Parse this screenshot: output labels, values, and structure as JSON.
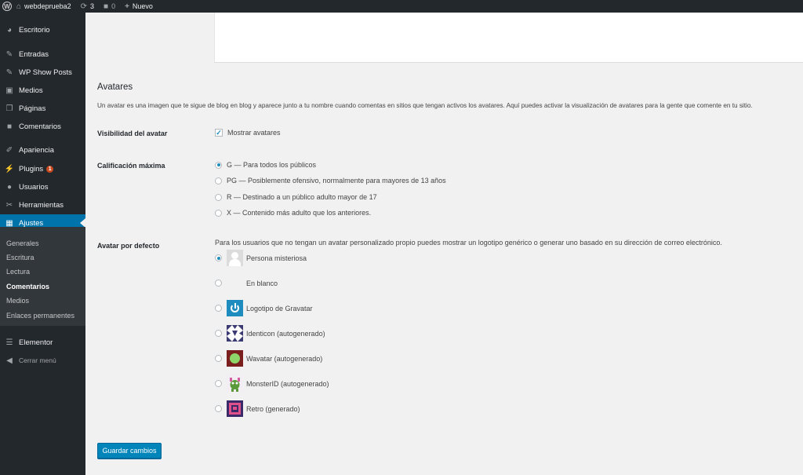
{
  "adminbar": {
    "site_name": "webdeprueba2",
    "updates_count": "3",
    "comments_count": "0",
    "new_label": "Nuevo"
  },
  "sidebar": {
    "items": [
      {
        "label": "Escritorio",
        "icon": "dashboard-icon"
      },
      {
        "label": "Entradas",
        "icon": "pin-icon"
      },
      {
        "label": "WP Show Posts",
        "icon": "pin-icon"
      },
      {
        "label": "Medios",
        "icon": "media-icon"
      },
      {
        "label": "Páginas",
        "icon": "pages-icon"
      },
      {
        "label": "Comentarios",
        "icon": "comment-icon"
      },
      {
        "label": "Apariencia",
        "icon": "brush-icon"
      },
      {
        "label": "Plugins",
        "icon": "plugin-icon",
        "badge": "1"
      },
      {
        "label": "Usuarios",
        "icon": "user-icon"
      },
      {
        "label": "Herramientas",
        "icon": "wrench-icon"
      },
      {
        "label": "Ajustes",
        "icon": "settings-icon",
        "active": true
      },
      {
        "label": "Elementor",
        "icon": "elementor-icon"
      },
      {
        "label": "Cerrar menú",
        "icon": "collapse-icon"
      }
    ],
    "submenu": [
      "Generales",
      "Escritura",
      "Lectura",
      "Comentarios",
      "Medios",
      "Enlaces permanentes"
    ],
    "submenu_current": "Comentarios"
  },
  "section": {
    "title": "Avatares",
    "description": "Un avatar es una imagen que te sigue de blog en blog y aparece junto a tu nombre cuando comentas en sitios que tengan activos los avatares. Aquí puedes activar la visualización de avatares para la gente que comente en tu sitio."
  },
  "visibility": {
    "label": "Visibilidad del avatar",
    "checkbox_label": "Mostrar avatares",
    "checked": true
  },
  "rating": {
    "label": "Calificación máxima",
    "options": [
      "G — Para todos los públicos",
      "PG — Posiblemente ofensivo, normalmente para mayores de 13 años",
      "R — Destinado a un público adulto mayor de 17",
      "X — Contenido más adulto que los anteriores."
    ],
    "selected": 0
  },
  "default_avatar": {
    "label": "Avatar por defecto",
    "description": "Para los usuarios que no tengan un avatar personalizado propio puedes mostrar un logotipo genérico o generar uno basado en su dirección de correo electrónico.",
    "options": [
      "Persona misteriosa",
      "En blanco",
      "Logotipo de Gravatar",
      "Identicon (autogenerado)",
      "Wavatar (autogenerado)",
      "MonsterID (autogenerado)",
      "Retro (generado)"
    ],
    "selected": 0
  },
  "save_button": "Guardar cambios",
  "colors": {
    "admin_bg": "#23282d",
    "accent": "#0073aa",
    "button": "#0085ba",
    "badge": "#ca4a1f"
  }
}
